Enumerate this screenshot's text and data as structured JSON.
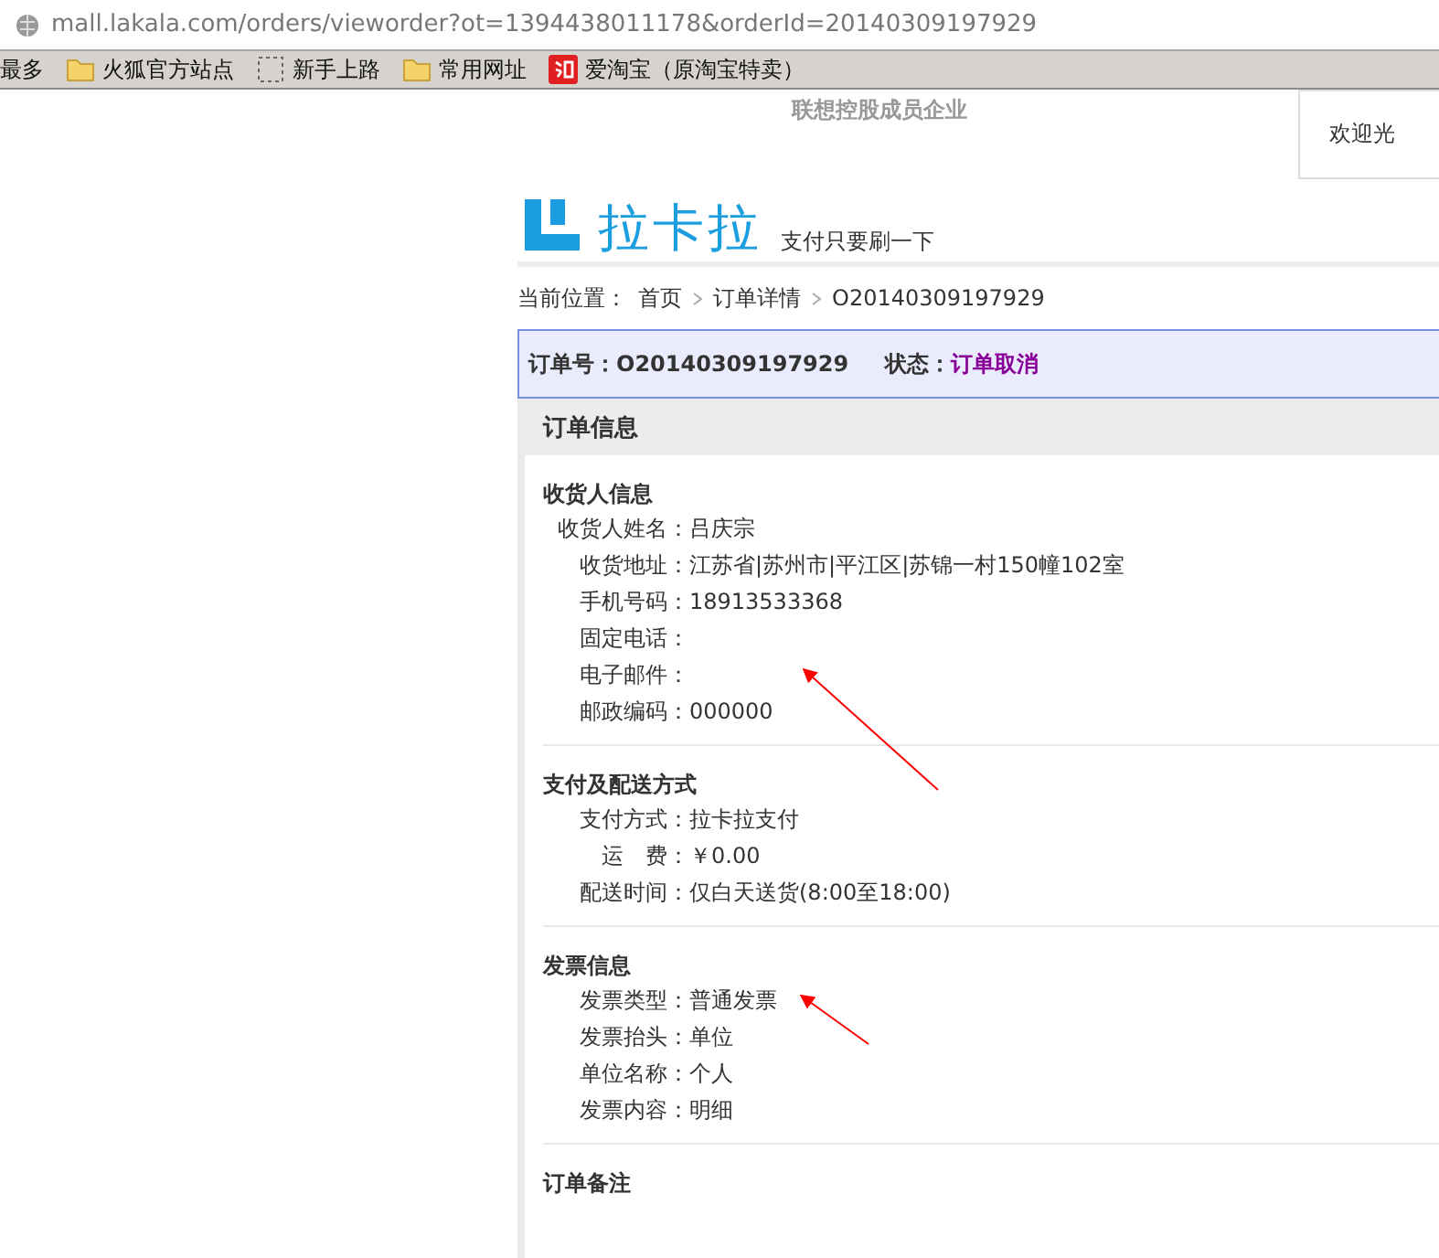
{
  "browser": {
    "url": "mall.lakala.com/orders/vieworder?ot=1394438011178&orderId=20140309197929",
    "bookmarks": [
      {
        "label": "最多",
        "kind": "text"
      },
      {
        "label": "火狐官方站点",
        "kind": "folder"
      },
      {
        "label": "新手上路",
        "kind": "page"
      },
      {
        "label": "常用网址",
        "kind": "folder"
      },
      {
        "label": "爱淘宝（原淘宝特卖）",
        "kind": "taobao"
      }
    ]
  },
  "header": {
    "tagline": "联想控股成员企业",
    "welcome": "欢迎光",
    "logo_text": "拉卡拉",
    "slogan": "支付只要刷一下"
  },
  "breadcrumb": {
    "label": "当前位置：",
    "items": [
      "首页",
      "订单详情",
      "O20140309197929"
    ]
  },
  "order_bar": {
    "number_label": "订单号：",
    "number": "O20140309197929",
    "status_label": "状态：",
    "status": "订单取消"
  },
  "panel": {
    "title": "订单信息",
    "sections": [
      {
        "title": "收货人信息",
        "fields": [
          {
            "label": "收货人姓名：",
            "value": "吕庆宗"
          },
          {
            "label": "收货地址：",
            "value": "江苏省|苏州市|平江区|苏锦一村150幢102室"
          },
          {
            "label": "手机号码：",
            "value": "18913533368"
          },
          {
            "label": "固定电话："
          },
          {
            "label": "电子邮件："
          },
          {
            "label": "邮政编码：",
            "value": "000000"
          }
        ]
      },
      {
        "title": "支付及配送方式",
        "fields": [
          {
            "label": "支付方式：",
            "value": "拉卡拉支付"
          },
          {
            "label": "运　费：",
            "value": "￥0.00"
          },
          {
            "label": "配送时间：",
            "value": "仅白天送货(8:00至18:00)"
          }
        ]
      },
      {
        "title": "发票信息",
        "fields": [
          {
            "label": "发票类型：",
            "value": "普通发票"
          },
          {
            "label": "发票抬头：",
            "value": "单位"
          },
          {
            "label": "单位名称：",
            "value": "个人"
          },
          {
            "label": "发票内容：",
            "value": "明细"
          }
        ]
      },
      {
        "title": "订单备注"
      }
    ]
  }
}
